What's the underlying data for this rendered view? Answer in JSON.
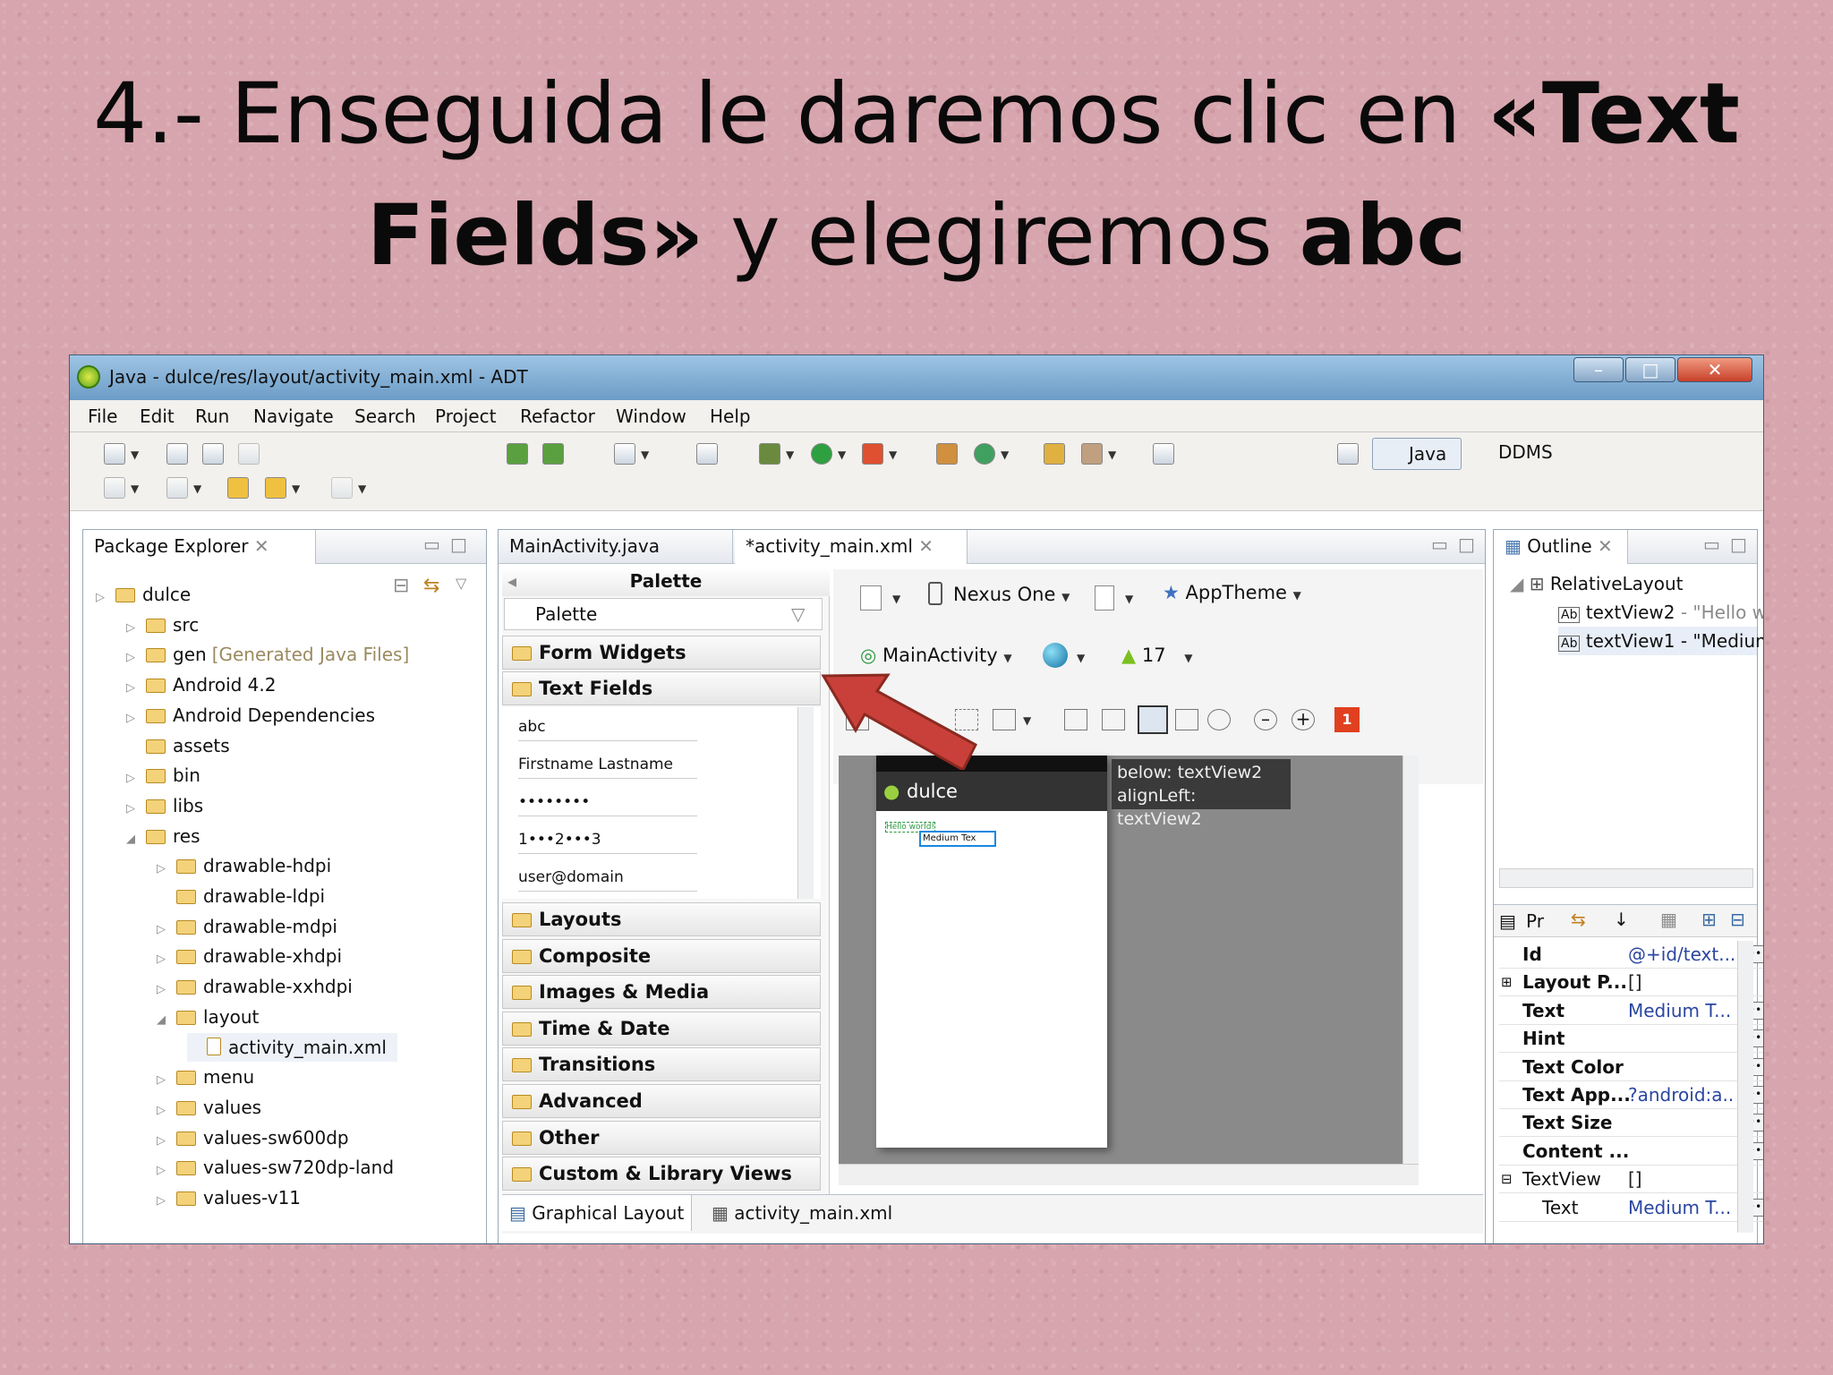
{
  "slide": {
    "title_line1_prefix": "4.- Enseguida le daremos clic en ",
    "title_line1_bold": "«Text",
    "title_line2_bold1": "Fields»",
    "title_line2_mid": " y elegiremos ",
    "title_line2_bold2": "abc"
  },
  "window": {
    "title": "Java - dulce/res/layout/activity_main.xml - ADT"
  },
  "menu": [
    "File",
    "Edit",
    "Run",
    "Navigate",
    "Search",
    "Project",
    "Refactor",
    "Window",
    "Help"
  ],
  "perspectives": {
    "java": "Java",
    "ddms": "DDMS"
  },
  "package_explorer": {
    "title": "Package Explorer",
    "items": [
      {
        "label": "dulce",
        "extra": ""
      },
      {
        "label": "src",
        "extra": ""
      },
      {
        "label": "gen",
        "extra": "[Generated Java Files]"
      },
      {
        "label": "Android 4.2",
        "extra": ""
      },
      {
        "label": "Android Dependencies",
        "extra": ""
      },
      {
        "label": "assets",
        "extra": ""
      },
      {
        "label": "bin",
        "extra": ""
      },
      {
        "label": "libs",
        "extra": ""
      },
      {
        "label": "res",
        "extra": ""
      },
      {
        "label": "drawable-hdpi",
        "extra": ""
      },
      {
        "label": "drawable-ldpi",
        "extra": ""
      },
      {
        "label": "drawable-mdpi",
        "extra": ""
      },
      {
        "label": "drawable-xhdpi",
        "extra": ""
      },
      {
        "label": "drawable-xxhdpi",
        "extra": ""
      },
      {
        "label": "layout",
        "extra": ""
      },
      {
        "label": "activity_main.xml",
        "extra": ""
      },
      {
        "label": "menu",
        "extra": ""
      },
      {
        "label": "values",
        "extra": ""
      },
      {
        "label": "values-sw600dp",
        "extra": ""
      },
      {
        "label": "values-sw720dp-land",
        "extra": ""
      },
      {
        "label": "values-v11",
        "extra": ""
      }
    ]
  },
  "editor": {
    "tabs": [
      "MainActivity.java",
      "*activity_main.xml"
    ],
    "bottom_tabs": [
      "Graphical Layout",
      "activity_main.xml"
    ]
  },
  "palette": {
    "header": "Palette",
    "dropdown": "Palette",
    "form_widgets": "Form Widgets",
    "text_fields": "Text Fields",
    "fields": [
      "abc",
      "Firstname Lastname",
      "••••••••",
      "1•••2•••3",
      "user@domain"
    ],
    "categories": [
      "Layouts",
      "Composite",
      "Images & Media",
      "Time & Date",
      "Transitions",
      "Advanced",
      "Other",
      "Custom & Library Views"
    ]
  },
  "canvas": {
    "device": "Nexus One",
    "theme": "AppTheme",
    "activity": "MainActivity",
    "api": "17",
    "app_name": "dulce",
    "hint_line1": "below: textView2",
    "hint_line2": "alignLeft: textView2",
    "error_count": "1",
    "hello": "Hello world!",
    "medium": "Medium Tex"
  },
  "outline": {
    "title": "Outline",
    "root": "RelativeLayout",
    "nodes": [
      {
        "name": "textView2",
        "value": "- \"Hello worl"
      },
      {
        "name": "textView1",
        "value": "- \"Medium T"
      }
    ]
  },
  "properties": {
    "header_label": "Pr",
    "rows": [
      {
        "key": "Id",
        "value": "@+id/text..."
      },
      {
        "key": "Layout P...",
        "value": "[]"
      },
      {
        "key": "Text",
        "value": "Medium T..."
      },
      {
        "key": "Hint",
        "value": ""
      },
      {
        "key": "Text Color",
        "value": ""
      },
      {
        "key": "Text App...",
        "value": "?android:a..."
      },
      {
        "key": "Text Size",
        "value": ""
      },
      {
        "key": "Content ...",
        "value": ""
      },
      {
        "key": "TextView",
        "value": "[]"
      },
      {
        "key": "Text",
        "value": "Medium T..."
      }
    ]
  },
  "colors": {
    "arrow": "#c9403a",
    "title_bar": "#6b9cc6",
    "error_badge": "#e04020"
  }
}
